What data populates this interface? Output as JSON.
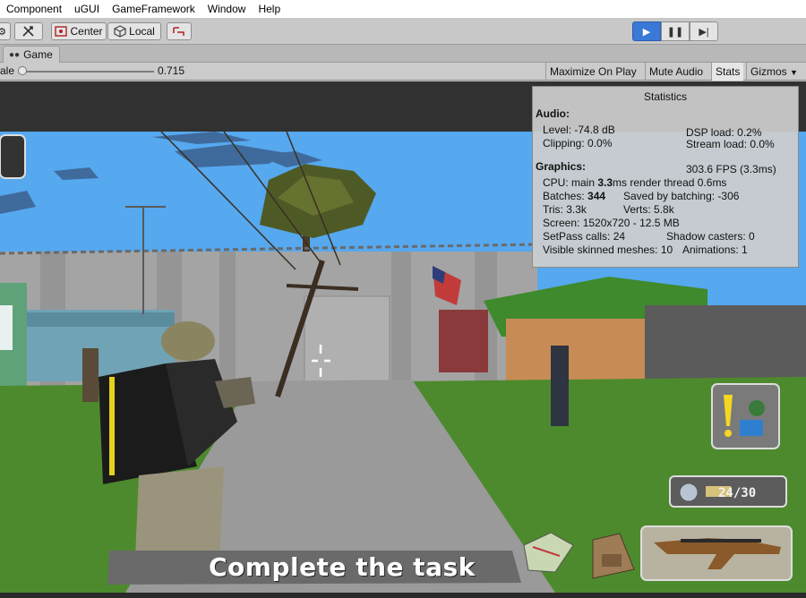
{
  "menu": {
    "items": [
      "Component",
      "uGUI",
      "GameFramework",
      "Window",
      "Help"
    ]
  },
  "toolbar": {
    "center_label": "Center",
    "local_label": "Local"
  },
  "tabs": {
    "game_label": "Game"
  },
  "game_view": {
    "scale_label": "ale",
    "scale_value": "0.715",
    "maximize_label": "Maximize On Play",
    "mute_label": "Mute Audio",
    "stats_label": "Stats",
    "gizmos_label": "Gizmos"
  },
  "stats": {
    "title": "Statistics",
    "audio_header": "Audio:",
    "level": "Level: -74.8 dB",
    "clipping": "Clipping: 0.0%",
    "dsp_load": "DSP load: 0.2%",
    "stream_load": "Stream load: 0.0%",
    "graphics_header": "Graphics:",
    "fps": "303.6 FPS (3.3ms)",
    "cpu_prefix": "CPU: main ",
    "cpu_main_value": "3.3",
    "cpu_suffix": "ms  render thread 0.6ms",
    "batches_prefix": "Batches: ",
    "batches_value": "344",
    "saved_by_batching": "Saved by batching: -306",
    "tris": "Tris: 3.3k",
    "verts": "Verts: 5.8k",
    "screen": "Screen: 1520x720 - 12.5 MB",
    "setpass": "SetPass calls: 24",
    "shadow_casters": "Shadow casters: 0",
    "skinned_meshes": "Visible skinned meshes: 10",
    "animations": "Animations: 1"
  },
  "hud": {
    "task_text": "Complete the task",
    "ammo": "24/30"
  },
  "icons": {
    "transform_tool": "transform-tools-icon",
    "center": "pivot-center-icon",
    "local": "local-space-icon",
    "play": "play-icon",
    "pause": "pause-icon",
    "step": "step-icon",
    "game_tab": "gamepad-icon",
    "map": "map-icon",
    "backpack": "backpack-icon",
    "weapon": "rifle-icon",
    "inventory_alert": "alert-icon",
    "crosshair": "crosshair-icon",
    "reload": "reload-icon",
    "bullet": "bullet-icon"
  },
  "colors": {
    "play_active": "#3a79d6",
    "sky": "#56a8ef",
    "wall": "#a4a4a4",
    "grass": "#4d8a2e",
    "hud_panel": "#6a6a6a",
    "alert_yellow": "#f5d623"
  }
}
